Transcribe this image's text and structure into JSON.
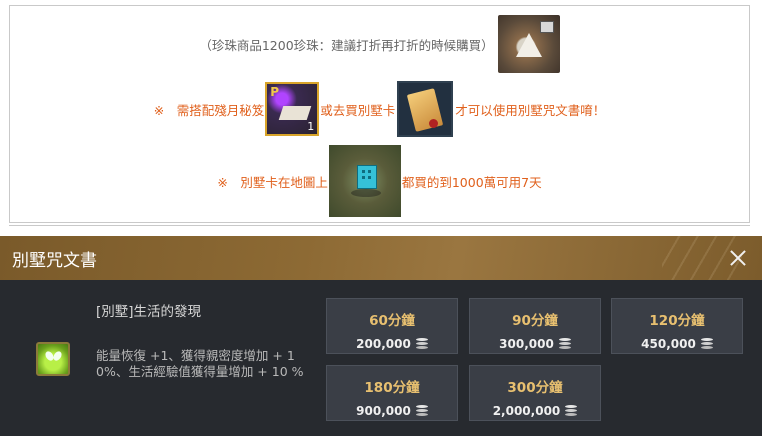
{
  "notice": {
    "line1": "（珍珠商品1200珍珠：建議打折再打折的時候購買）",
    "line2_a": "※　需搭配殘月秘笈",
    "line2_b": "或去買別墅卡",
    "line2_c": "才可以使用別墅咒文書唷！",
    "line3_a": "※　別墅卡在地圖上",
    "line3_b": "都買的到1000萬可用7天",
    "book_badge_letter": "P",
    "book_badge_count": "1"
  },
  "panel": {
    "title": "別墅咒文書",
    "item_name": "[別墅]生活的發現",
    "item_desc": "能量恢復 +1、獲得親密度增加 + 10%、生活經驗值獲得量增加 + 10 %",
    "options": [
      {
        "duration": "60分鐘",
        "price": "200,000"
      },
      {
        "duration": "90分鐘",
        "price": "300,000"
      },
      {
        "duration": "120分鐘",
        "price": "450,000"
      },
      {
        "duration": "180分鐘",
        "price": "900,000"
      },
      {
        "duration": "300分鐘",
        "price": "2,000,000"
      }
    ]
  },
  "icons": [
    "tent-icon",
    "secret-book-icon",
    "villa-card-icon",
    "map-villa-icon",
    "close-icon",
    "life-item-icon",
    "silver-coin-icon"
  ],
  "colors": {
    "notice_orange": "#e0601c",
    "header_gold": "#8d6a34",
    "duration_gold": "#e8c070",
    "panel_bg": "#272a2f"
  }
}
